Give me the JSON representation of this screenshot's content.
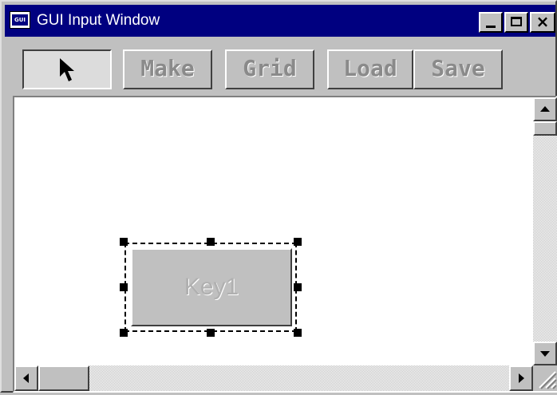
{
  "window": {
    "title": "GUI Input Window",
    "app_icon": "gui-app-icon",
    "app_icon_text": "GUI",
    "controls": [
      "minimize-icon",
      "maximize-icon",
      "close-icon"
    ],
    "close_glyph": "×"
  },
  "toolbar": {
    "select_tool_icon": "arrow-pointer-icon",
    "select_tool_pressed": true,
    "make_label": "Make",
    "grid_label": "Grid",
    "load_label": "Load",
    "save_label": "Save",
    "buttons_disabled": true
  },
  "canvas": {
    "selected_widget": {
      "type": "button",
      "label": "Key1",
      "label_disabled": true
    }
  },
  "scrollbars": {
    "vertical": {
      "icons": [
        "scroll-up-arrow-icon",
        "scroll-down-arrow-icon"
      ]
    },
    "horizontal": {
      "icons": [
        "scroll-left-arrow-icon",
        "scroll-right-arrow-icon"
      ]
    }
  },
  "colors": {
    "titlebar": "#000080",
    "face": "#c0c0c0",
    "canvas": "#ffffff",
    "disabled_text": "#8a8a8a"
  }
}
